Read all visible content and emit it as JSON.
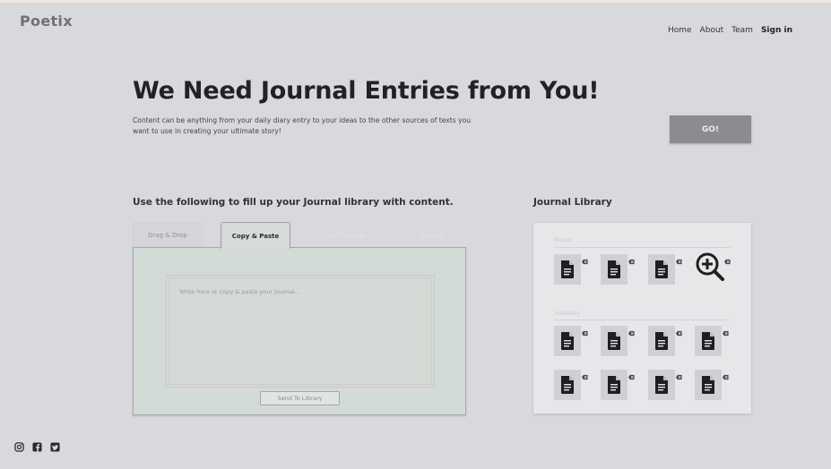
{
  "app": {
    "logo": "Poetix"
  },
  "nav": {
    "items": [
      {
        "label": "Home"
      },
      {
        "label": "About"
      },
      {
        "label": "Team"
      },
      {
        "label": "Sign in"
      }
    ]
  },
  "hero": {
    "title": "We Need Journal Entries from You!",
    "subtitle": "Content can be anything from your daily diary entry to your ideas to the other sources of texts you want to use in creating your ultimate story!",
    "go_label": "GO!"
  },
  "input_section": {
    "title": "Use the following to fill up your Journal library with content.",
    "tabs": [
      {
        "label": "Drag & Drop"
      },
      {
        "label": "Copy & Paste"
      },
      {
        "label": "Cloud Storage"
      },
      {
        "label": "Plugins"
      }
    ],
    "active_tab": "Copy & Paste",
    "editor_placeholder": "Write here or copy & paste your journal...",
    "send_label": "Send To Library"
  },
  "library": {
    "title": "Journal Library",
    "groups": [
      {
        "label": "Recent",
        "file_count": 3,
        "has_zoom": true
      },
      {
        "label": "Yesterday",
        "file_count": 8
      }
    ]
  },
  "footer": {
    "socials": [
      "instagram-icon",
      "facebook-icon",
      "twitter-icon"
    ]
  },
  "colors": {
    "background": "#d9d8dc",
    "go_button": "#8b8b92",
    "library_card": "#e7e7ea",
    "editor_panel": "#d3dbd6"
  }
}
